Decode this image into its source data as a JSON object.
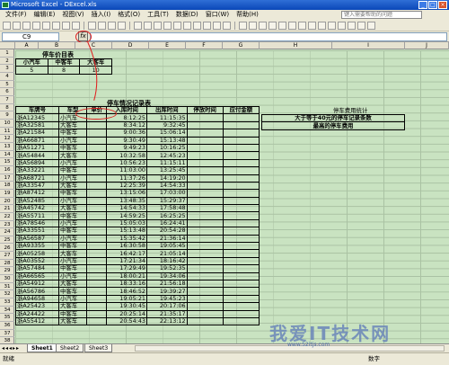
{
  "window": {
    "title": "Microsoft Excel - DExcel.xls"
  },
  "menu": [
    "文件(F)",
    "编辑(E)",
    "视图(V)",
    "插入(I)",
    "格式(O)",
    "工具(T)",
    "数据(D)",
    "窗口(W)",
    "帮助(H)"
  ],
  "help_placeholder": "键入需要帮助的问题",
  "formula": {
    "name_box": "C9",
    "fx": "fx"
  },
  "columns": [
    "A",
    "B",
    "C",
    "D",
    "E",
    "F",
    "G",
    "H",
    "I",
    "J"
  ],
  "price_table": {
    "title": "停车价目表",
    "headers": [
      "小汽车",
      "中客车",
      "大客车"
    ],
    "values": [
      "5",
      "8",
      "10"
    ]
  },
  "record_table": {
    "title": "停车情况记录表",
    "headers": [
      "车牌号",
      "车型",
      "单价",
      "入库时间",
      "出库时间",
      "停放时间",
      "应付金额"
    ],
    "rows": [
      [
        "浙A12345",
        "小汽车",
        "8:12:25",
        "11:15:35"
      ],
      [
        "浙A32581",
        "大客车",
        "8:34:12",
        "9:32:45"
      ],
      [
        "浙A21584",
        "中客车",
        "9:00:36",
        "15:06:14"
      ],
      [
        "浙A66871",
        "小汽车",
        "9:30:49",
        "15:13:48"
      ],
      [
        "浙A51271",
        "中客车",
        "9:49:23",
        "10:16:25"
      ],
      [
        "浙A54844",
        "大客车",
        "10:32:58",
        "12:45:23"
      ],
      [
        "浙A56894",
        "小汽车",
        "10:56:23",
        "11:15:11"
      ],
      [
        "浙A33221",
        "中客车",
        "11:03:00",
        "13:25:45"
      ],
      [
        "浙A68721",
        "小汽车",
        "11:37:26",
        "14:19:20"
      ],
      [
        "浙A33547",
        "大客车",
        "12:25:39",
        "14:54:33"
      ],
      [
        "浙A87412",
        "中客车",
        "13:15:06",
        "17:03:00"
      ],
      [
        "浙A52485",
        "小汽车",
        "13:48:35",
        "15:29:37"
      ],
      [
        "浙A45742",
        "大客车",
        "14:54:33",
        "17:58:48"
      ],
      [
        "浙A55711",
        "中客车",
        "14:59:25",
        "16:25:25"
      ],
      [
        "浙A78546",
        "小汽车",
        "15:05:03",
        "16:24:41"
      ],
      [
        "浙A33551",
        "中客车",
        "15:13:48",
        "20:54:28"
      ],
      [
        "浙A56587",
        "小汽车",
        "15:35:42",
        "21:36:14"
      ],
      [
        "浙A93355",
        "中客车",
        "16:30:58",
        "19:05:45"
      ],
      [
        "浙A05258",
        "大客车",
        "16:42:17",
        "21:05:14"
      ],
      [
        "浙A03552",
        "小汽车",
        "17:21:34",
        "18:16:42"
      ],
      [
        "浙A57484",
        "中客车",
        "17:29:49",
        "19:52:35"
      ],
      [
        "浙A66565",
        "小汽车",
        "18:00:21",
        "19:34:06"
      ],
      [
        "浙A54912",
        "大客车",
        "18:33:16",
        "21:56:18"
      ],
      [
        "浙A56786",
        "中客车",
        "18:46:52",
        "19:39:27"
      ],
      [
        "浙A94658",
        "小汽车",
        "19:05:21",
        "19:45:23"
      ],
      [
        "浙A25423",
        "大客车",
        "19:30:45",
        "20:17:06"
      ],
      [
        "浙A24422",
        "中客车",
        "20:25:14",
        "21:35:17"
      ],
      [
        "浙A55412",
        "大客车",
        "20:54:43",
        "22:13:12"
      ]
    ]
  },
  "stats": {
    "title": "停车费用统计",
    "row1": "大于等于40元的停车记录条数",
    "row2": "最高的停车费用"
  },
  "sheet_tabs": [
    "Sheet1",
    "Sheet2",
    "Sheet3"
  ],
  "status": {
    "left": "就绪",
    "right": "数字"
  },
  "watermark": {
    "main": "我爱IT技术网",
    "sub": "www.52itjs.com"
  }
}
